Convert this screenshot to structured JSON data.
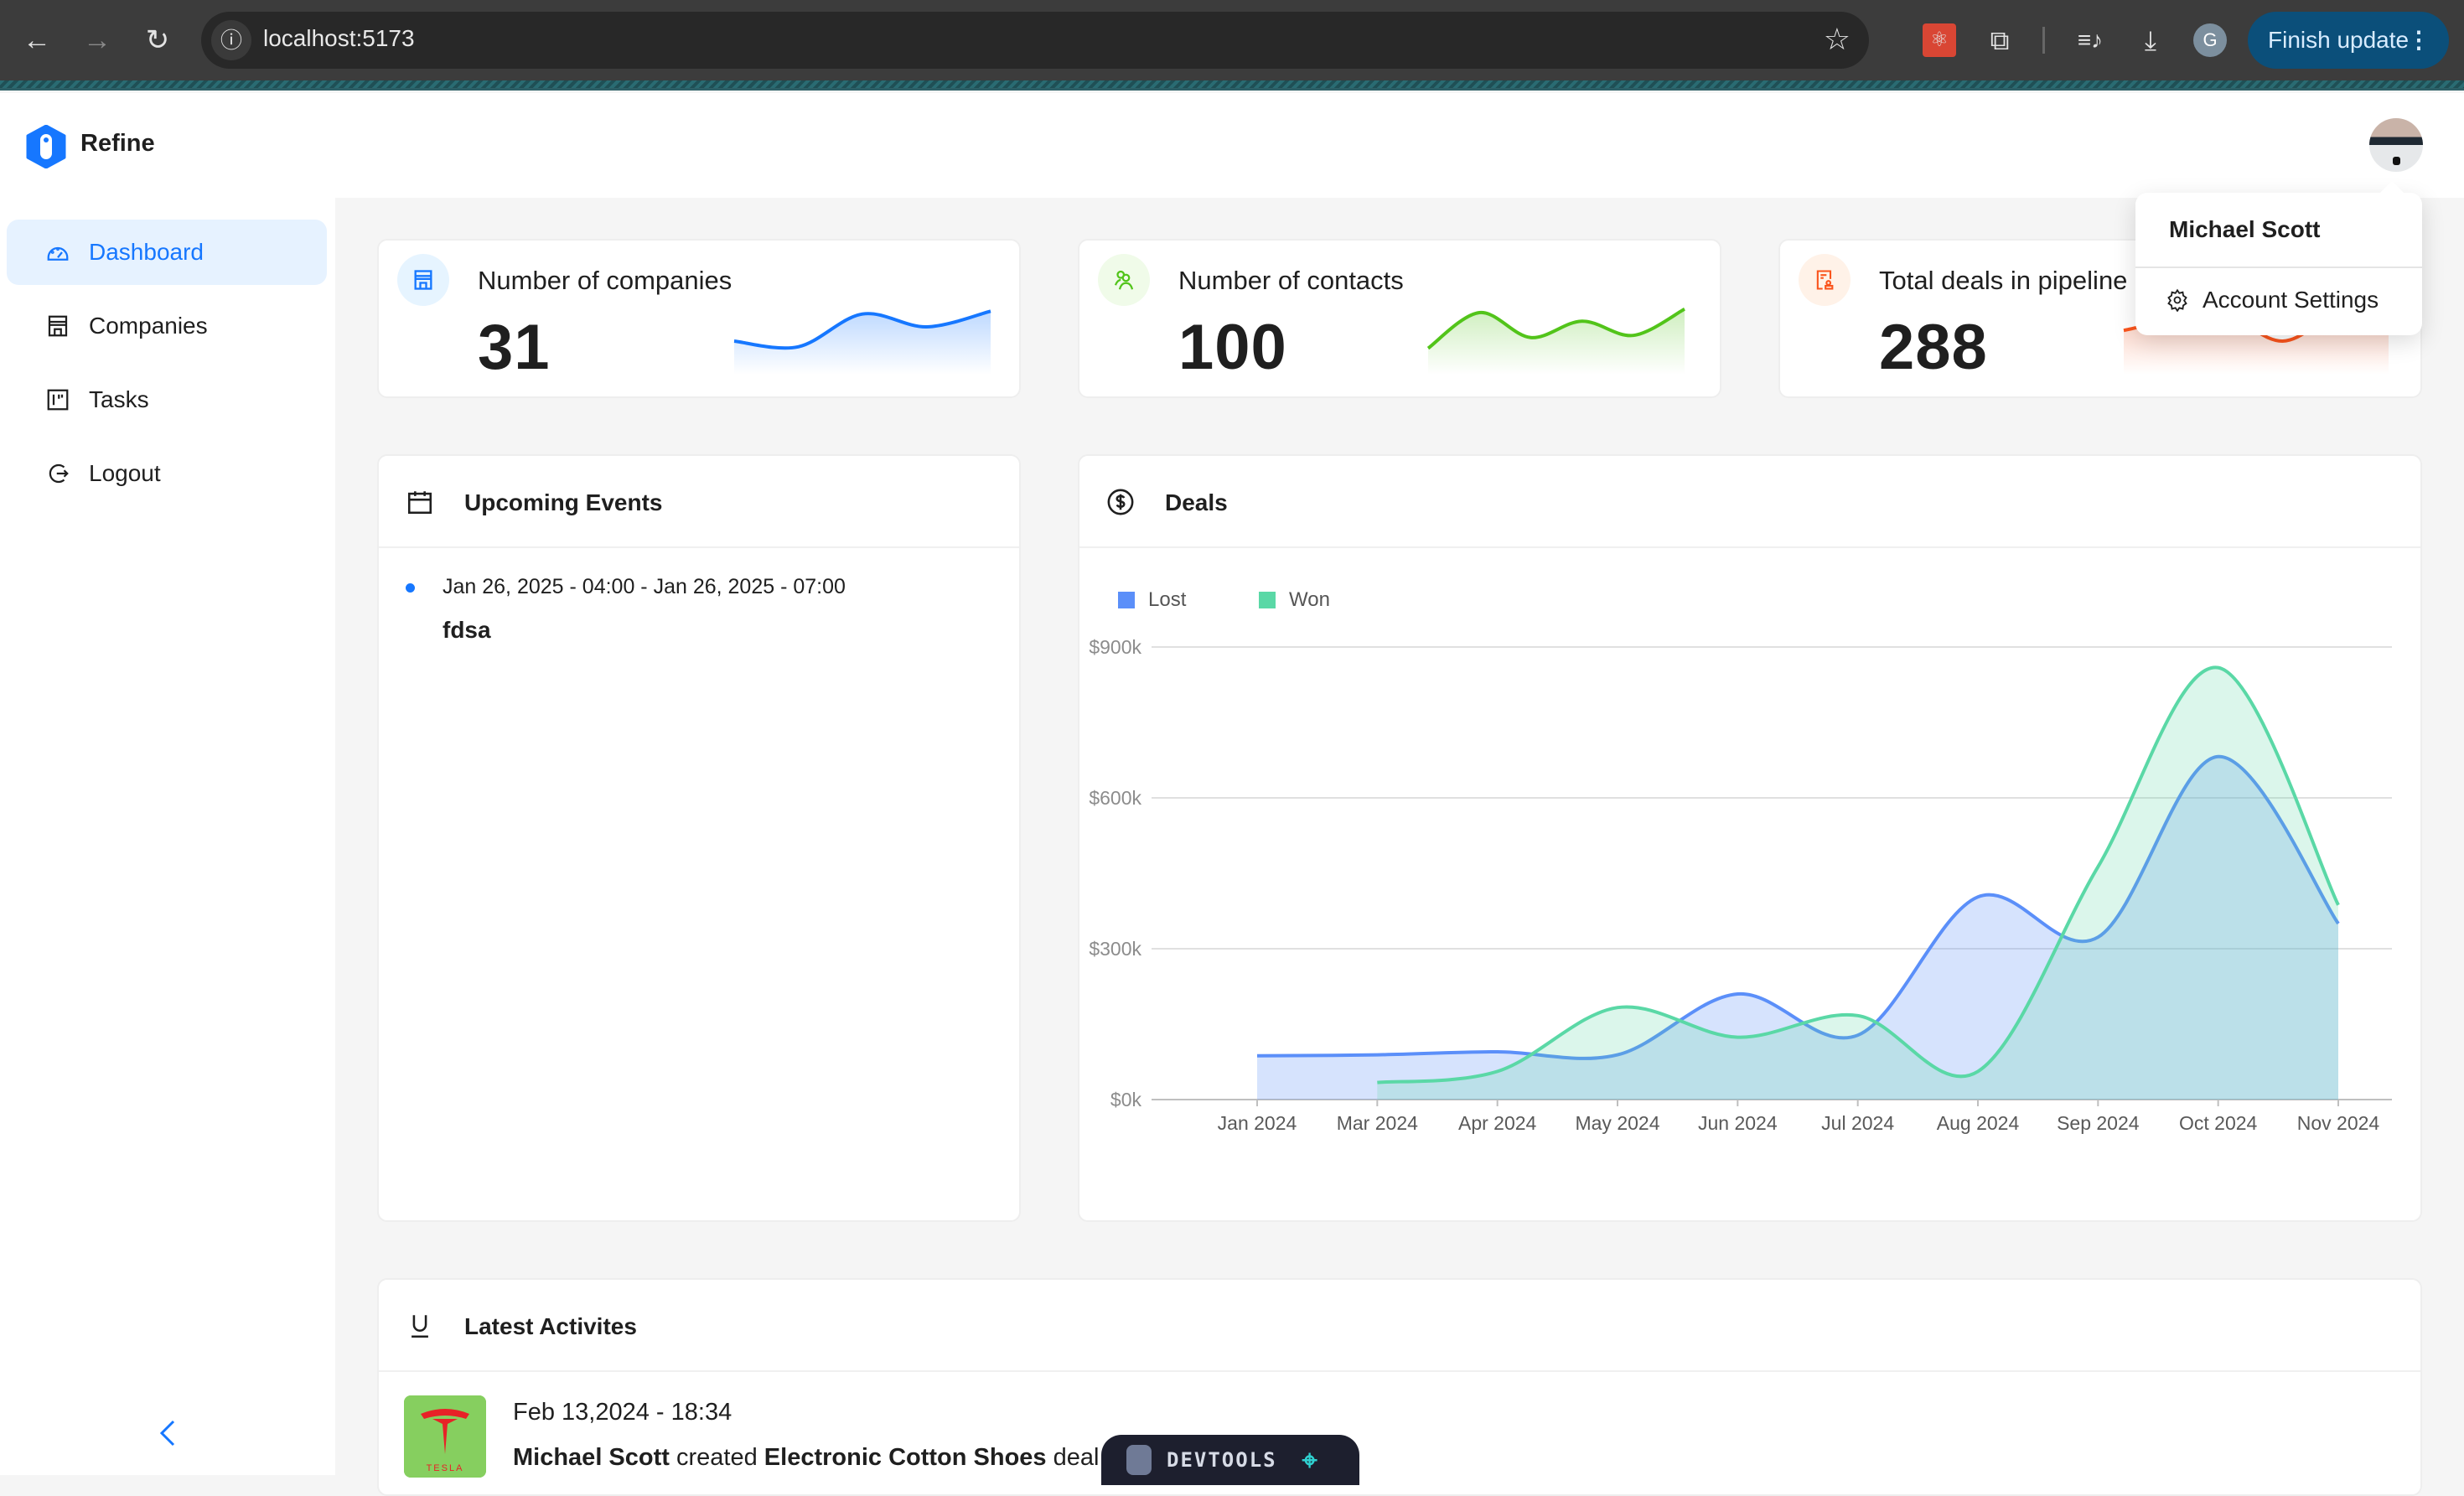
{
  "browser": {
    "url": "localhost:5173",
    "profile_initial": "G",
    "update_button": "Finish update",
    "icons": [
      "back-icon",
      "forward-icon",
      "reload-icon",
      "info-icon",
      "star-icon",
      "react-devtools-extension-icon",
      "extensions-icon",
      "media-icon",
      "download-icon",
      "menu-icon"
    ]
  },
  "app": {
    "brand": "Refine",
    "accent": "#1677ff"
  },
  "sidebar": {
    "items": [
      {
        "label": "Dashboard",
        "icon": "dashboard-icon",
        "active": true
      },
      {
        "label": "Companies",
        "icon": "shop-icon",
        "active": false
      },
      {
        "label": "Tasks",
        "icon": "project-icon",
        "active": false
      },
      {
        "label": "Logout",
        "icon": "logout-icon",
        "active": false
      }
    ],
    "collapse_icon": "chevron-left-icon"
  },
  "user_menu": {
    "name": "Michael Scott",
    "items": [
      {
        "label": "Account Settings",
        "icon": "gear-icon"
      }
    ]
  },
  "kpis": [
    {
      "title": "Number of companies",
      "value": "31",
      "color": "#1677ff",
      "bg": "#e6f4ff",
      "spark": [
        40,
        32,
        78,
        60,
        82
      ]
    },
    {
      "title": "Number of contacts",
      "value": "100",
      "color": "#52c41a",
      "bg": "#f0fbe9",
      "spark": [
        30,
        80,
        45,
        68,
        48,
        85
      ]
    },
    {
      "title": "Total deals in pipeline",
      "value": "288",
      "color": "#fa541c",
      "bg": "#fff2e8",
      "spark": [
        55,
        70,
        72,
        40,
        75,
        78
      ]
    }
  ],
  "events": {
    "title": "Upcoming Events",
    "items": [
      {
        "date": "Jan 26, 2025 - 04:00 - Jan 26, 2025 - 07:00",
        "title": "fdsa",
        "color": "#1677ff"
      }
    ]
  },
  "deals": {
    "title": "Deals"
  },
  "chart_data": {
    "type": "area",
    "title": "Deals",
    "xlabel": "",
    "ylabel": "",
    "categories": [
      "Jan 2024",
      "Mar 2024",
      "Apr 2024",
      "May 2024",
      "Jun 2024",
      "Jul 2024",
      "Aug 2024",
      "Sep 2024",
      "Oct 2024",
      "Nov 2024"
    ],
    "y_ticks": [
      "$0k",
      "$300k",
      "$600k",
      "$900k"
    ],
    "ylim": [
      0,
      900
    ],
    "y_unit": "k USD",
    "grid": true,
    "legend_position": "top-left",
    "series": [
      {
        "name": "Lost",
        "color": "#5b8ff9",
        "values": [
          87,
          89,
          95,
          89,
          210,
          128,
          403,
          323,
          682,
          350
        ]
      },
      {
        "name": "Won",
        "color": "#5ad8a6",
        "values": [
          null,
          34,
          56,
          183,
          124,
          167,
          56,
          463,
          859,
          387
        ]
      }
    ]
  },
  "activities": {
    "title": "Latest Activites",
    "items": [
      {
        "date": "Feb 13,2024 - 18:34",
        "user": "Michael Scott",
        "action": "created",
        "deal": "Electronic Cotton Shoes",
        "suffix": "deal in",
        "company_logo": "tesla-logo"
      }
    ]
  },
  "devtools": {
    "label": "DEVTOOLS"
  }
}
